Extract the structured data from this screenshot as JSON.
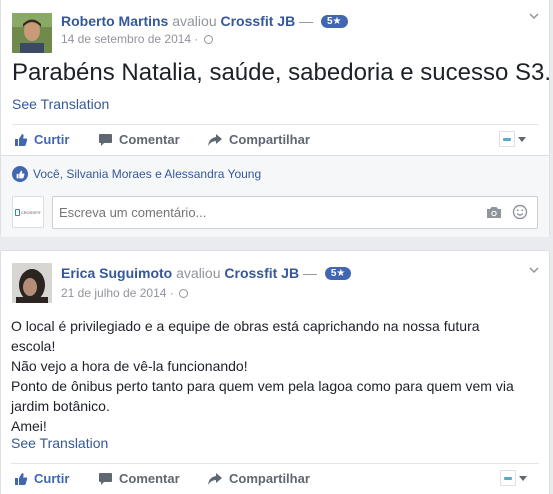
{
  "posts": [
    {
      "author": "Roberto Martins",
      "verb": "avaliou",
      "page": "Crossfit JB",
      "separator": "—",
      "rating": "5★",
      "date": "14 de setembro de 2014 ·",
      "text_lines": [
        "Parabéns Natalia, saúde, sabedoria e sucesso S3."
      ],
      "see_translation": "See Translation",
      "actions": {
        "like": "Curtir",
        "comment": "Comentar",
        "share": "Compartilhar"
      },
      "likes_text": "Você, Silvania Moraes e Alessandra Young",
      "comment_placeholder": "Escreva um comentário..."
    },
    {
      "author": "Erica Suguimoto",
      "verb": "avaliou",
      "page": "Crossfit JB",
      "separator": "—",
      "rating": "5★",
      "date": "21 de julho de 2014 ·",
      "text_lines": [
        "O local é privilegiado e a equipe de obras está caprichando na nossa futura",
        "escola!",
        "Não vejo a hora de vê-la funcionando!",
        "Ponto de ônibus perto tanto para quem vem pela lagoa como para quem vem via",
        "jardim botânico.",
        "Amei!"
      ],
      "see_translation": "See Translation",
      "actions": {
        "like": "Curtir",
        "comment": "Comentar",
        "share": "Compartilhar"
      }
    }
  ],
  "icons": [
    "chevron-down-icon",
    "globe-icon",
    "thumbs-up-icon",
    "comment-icon",
    "share-icon",
    "camera-icon",
    "smiley-icon"
  ],
  "colors": {
    "link": "#365899",
    "accent": "#4267b2",
    "muted": "#90949c",
    "background": "#e9ebee"
  }
}
